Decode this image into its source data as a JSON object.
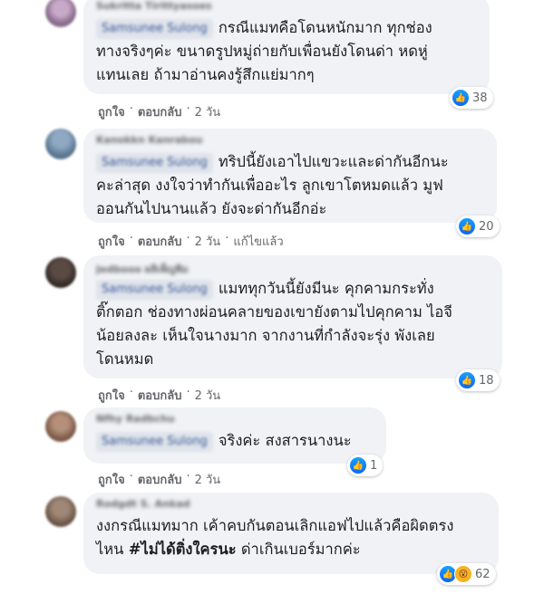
{
  "actions": {
    "like": "ถูกใจ",
    "reply": "ตอบกลับ",
    "dot": "·"
  },
  "comments": [
    {
      "name": "Sukritta Tirittyasoes",
      "tag": "Samsunee Sulong",
      "text": "กรณีแมทคือโดนหนักมาก ทุกช่อง\nทางจริงๆค่ะ ขนาดรูปหมู่ถ่ายกับเพื่อนยังโดนด่า หดหู่\nแทนเลย ถ้ามาอ่านคงรู้สึกแย่มากๆ",
      "reaction_count": "38",
      "time": "2 วัน"
    },
    {
      "name": "Kanokkn Kanrabou",
      "tag": "Samsunee Sulong",
      "text": "ทริปนี้ยังเอาไปแขวะและด่ากันอีกนะ\nคะล่าสุด งงใจว่าทำกันเพื่ออะไร ลูกเขาโตหมดแล้ว มูฟ\nออนกันไปนานแล้ว ยังจะด่ากันอีกอ่ะ",
      "reaction_count": "20",
      "time": "2 วัน",
      "edited": "แก้ไขแล้ว"
    },
    {
      "name": "Jedbooo ผลิเพ็ญพิม",
      "tag": "Samsunee Sulong",
      "text": "แมททุกวันนี้ยังมีนะ คุกคามกระทั่ง\nติ๊กตอก ช่องทางผ่อนคลายของเขายังตามไปคุกคาม ไอจี\nน้อยลงละ เห็นใจนางมาก จากงานที่กำลังจะรุ่ง พังเลย\nโดนหมด",
      "reaction_count": "18",
      "time": "2 วัน"
    },
    {
      "name": "Nfhy Radbchu",
      "tag": "Samsunee Sulong",
      "text": "จริงค่ะ สงสารนางนะ",
      "reaction_count": "1",
      "time": "2 วัน"
    },
    {
      "name": "Rodgdt S. Ankad",
      "text_pre": "งงกรณีแมทมาก เค้าคบกันตอนเลิกแอฟไปแล้วคือผิดตรง\nไหน ",
      "hashtag": "#ไม่ได้ติ่งใครนะ",
      "text_post": " ด่าเกินเบอร์มากค่ะ",
      "reaction_count": "62",
      "time": "2 วัน"
    }
  ]
}
